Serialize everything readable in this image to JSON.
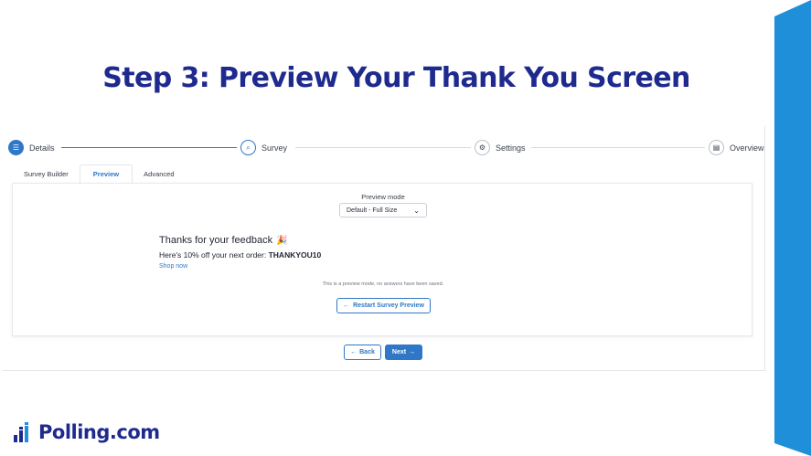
{
  "slide": {
    "title": "Step 3: Preview Your Thank You Screen"
  },
  "stepper": {
    "steps": [
      {
        "label": "Details",
        "icon": "list-icon",
        "state": "done"
      },
      {
        "label": "Survey",
        "icon": "survey-icon",
        "state": "active"
      },
      {
        "label": "Settings",
        "icon": "gear-icon",
        "state": "pending"
      },
      {
        "label": "Overview",
        "icon": "clipboard-icon",
        "state": "pending"
      }
    ]
  },
  "tabs": [
    {
      "label": "Survey Builder",
      "active": false
    },
    {
      "label": "Preview",
      "active": true
    },
    {
      "label": "Advanced",
      "active": false
    }
  ],
  "preview": {
    "mode_label": "Preview mode",
    "mode_value": "Default - Full Size",
    "thanks_title": "Thanks for your feedback",
    "offer_text": "Here's 10% off your next order: ",
    "offer_code": "THANKYOU10",
    "link_text": "Shop now",
    "note": "This is a preview mode, no answers have been saved.",
    "restart_label": "Restart Survey Preview"
  },
  "nav": {
    "back_label": "Back",
    "next_label": "Next"
  },
  "brand": {
    "name": "Polling.com"
  },
  "colors": {
    "accent": "#2f78c8",
    "title": "#1f2a8f",
    "band": "#1e8fd8"
  }
}
